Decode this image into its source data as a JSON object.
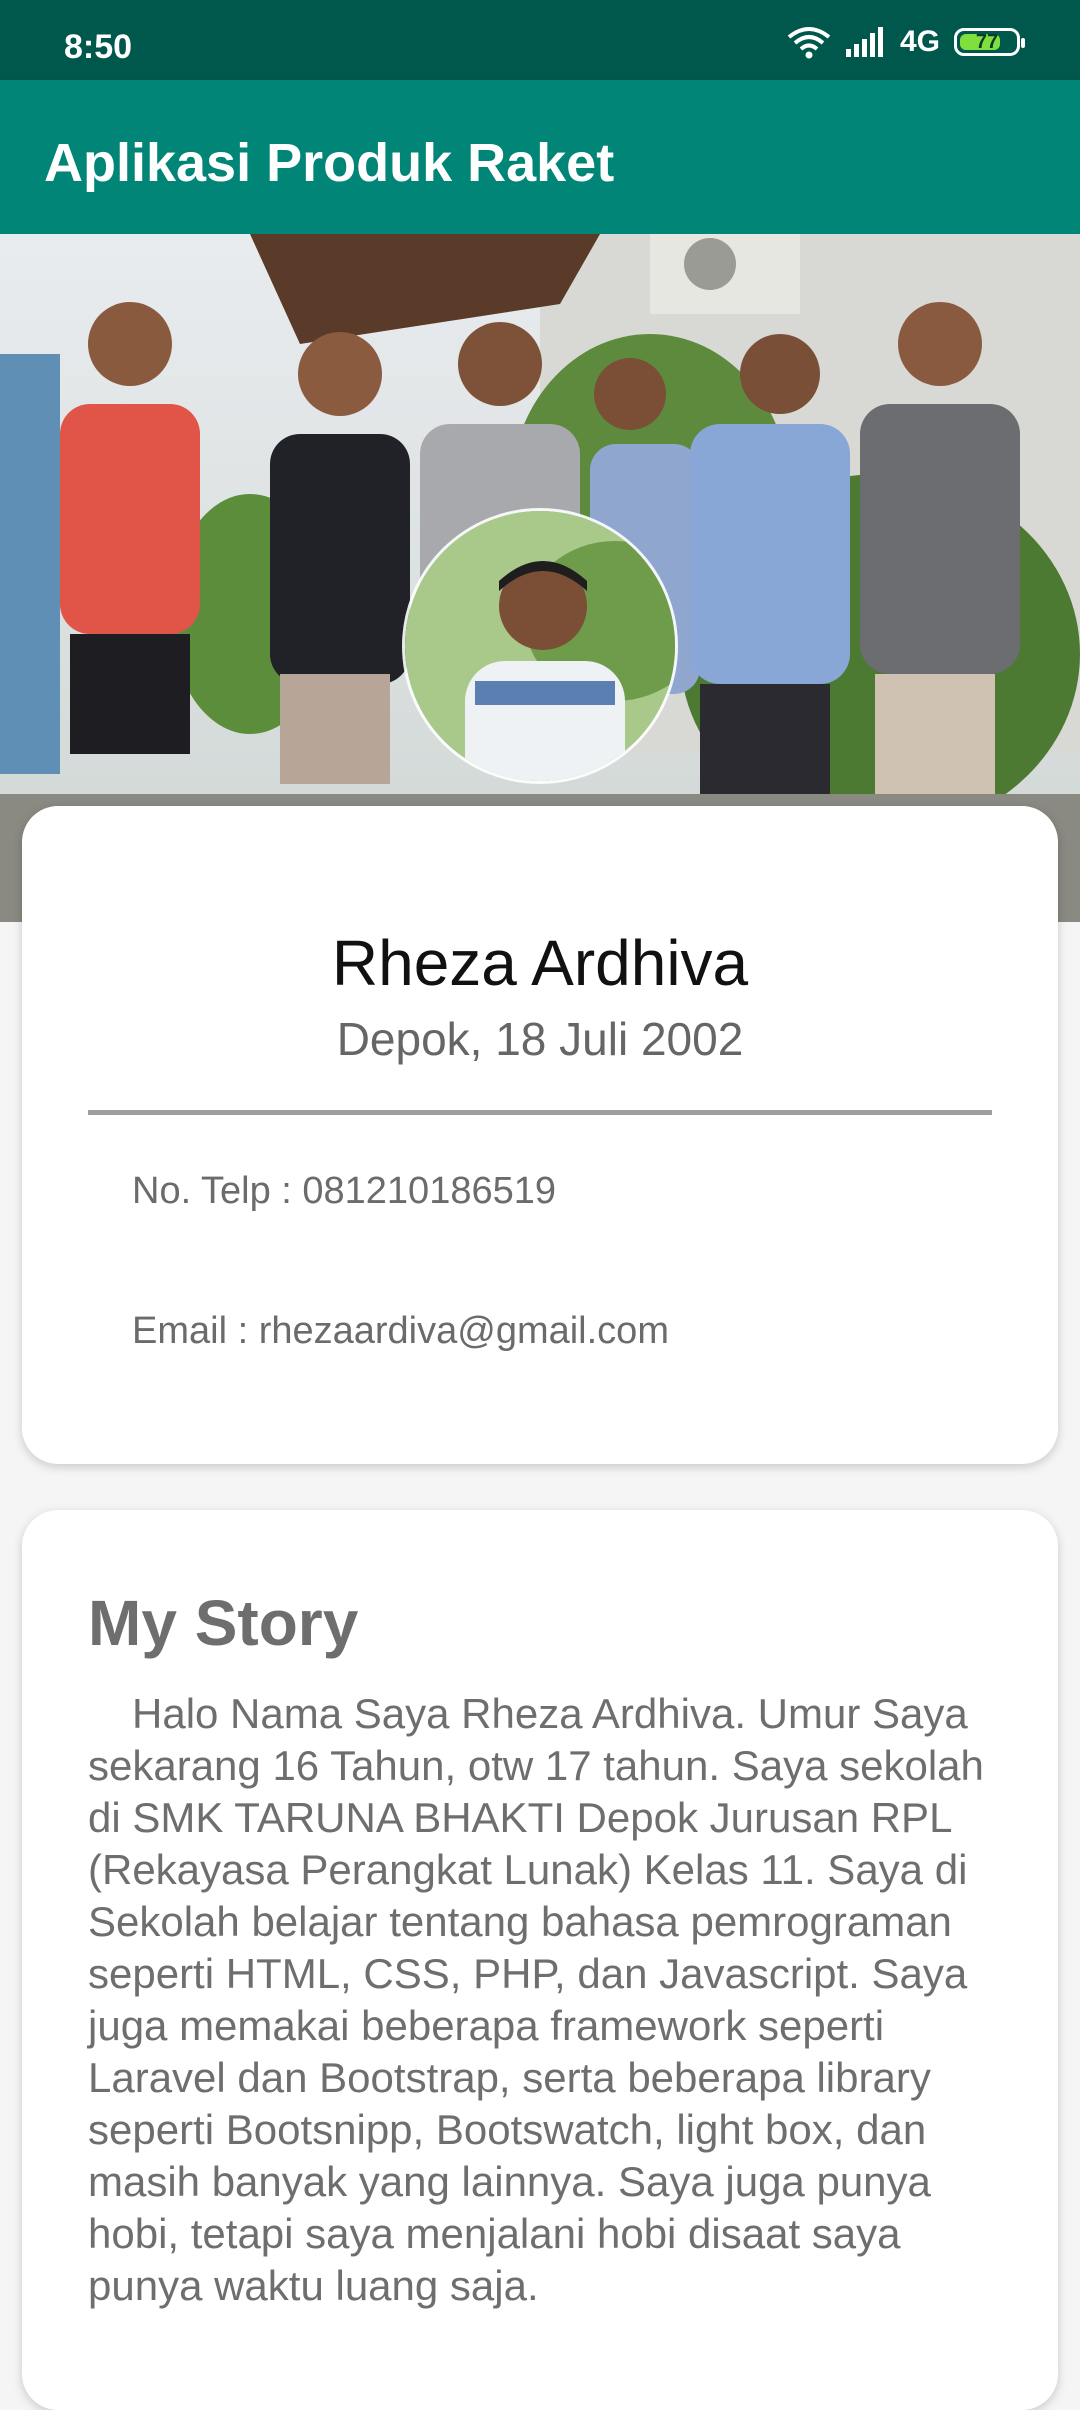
{
  "status_bar": {
    "time": "8:50",
    "network": "4G",
    "battery": "77",
    "battery_level_percent": 77
  },
  "app_bar": {
    "title": "Aplikasi Produk Raket"
  },
  "profile": {
    "name": "Rheza Ardhiva",
    "birth": "Depok, 18 Juli 2002",
    "phone": "No. Telp : 081210186519",
    "email": "Email : rhezaardiva@gmail.com"
  },
  "story": {
    "title": "My Story",
    "text": "Halo Nama Saya Rheza Ardhiva. Umur Saya sekarang 16 Tahun, otw 17 tahun. Saya sekolah di SMK TARUNA BHAKTI Depok Jurusan RPL (Rekayasa Perangkat Lunak) Kelas 11. Saya di Sekolah belajar tentang bahasa pemrograman seperti HTML, CSS, PHP, dan Javascript. Saya juga memakai beberapa framework seperti Laravel dan Bootstrap, serta beberapa library seperti Bootsnipp, Bootswatch, light box, dan masih banyak yang lainnya. Saya juga punya hobi, tetapi saya menjalani hobi disaat saya punya waktu luang saja."
  },
  "colors": {
    "status_bar": "#00574b",
    "app_bar": "#008577",
    "card": "#ffffff",
    "background": "#f5f5f5"
  }
}
